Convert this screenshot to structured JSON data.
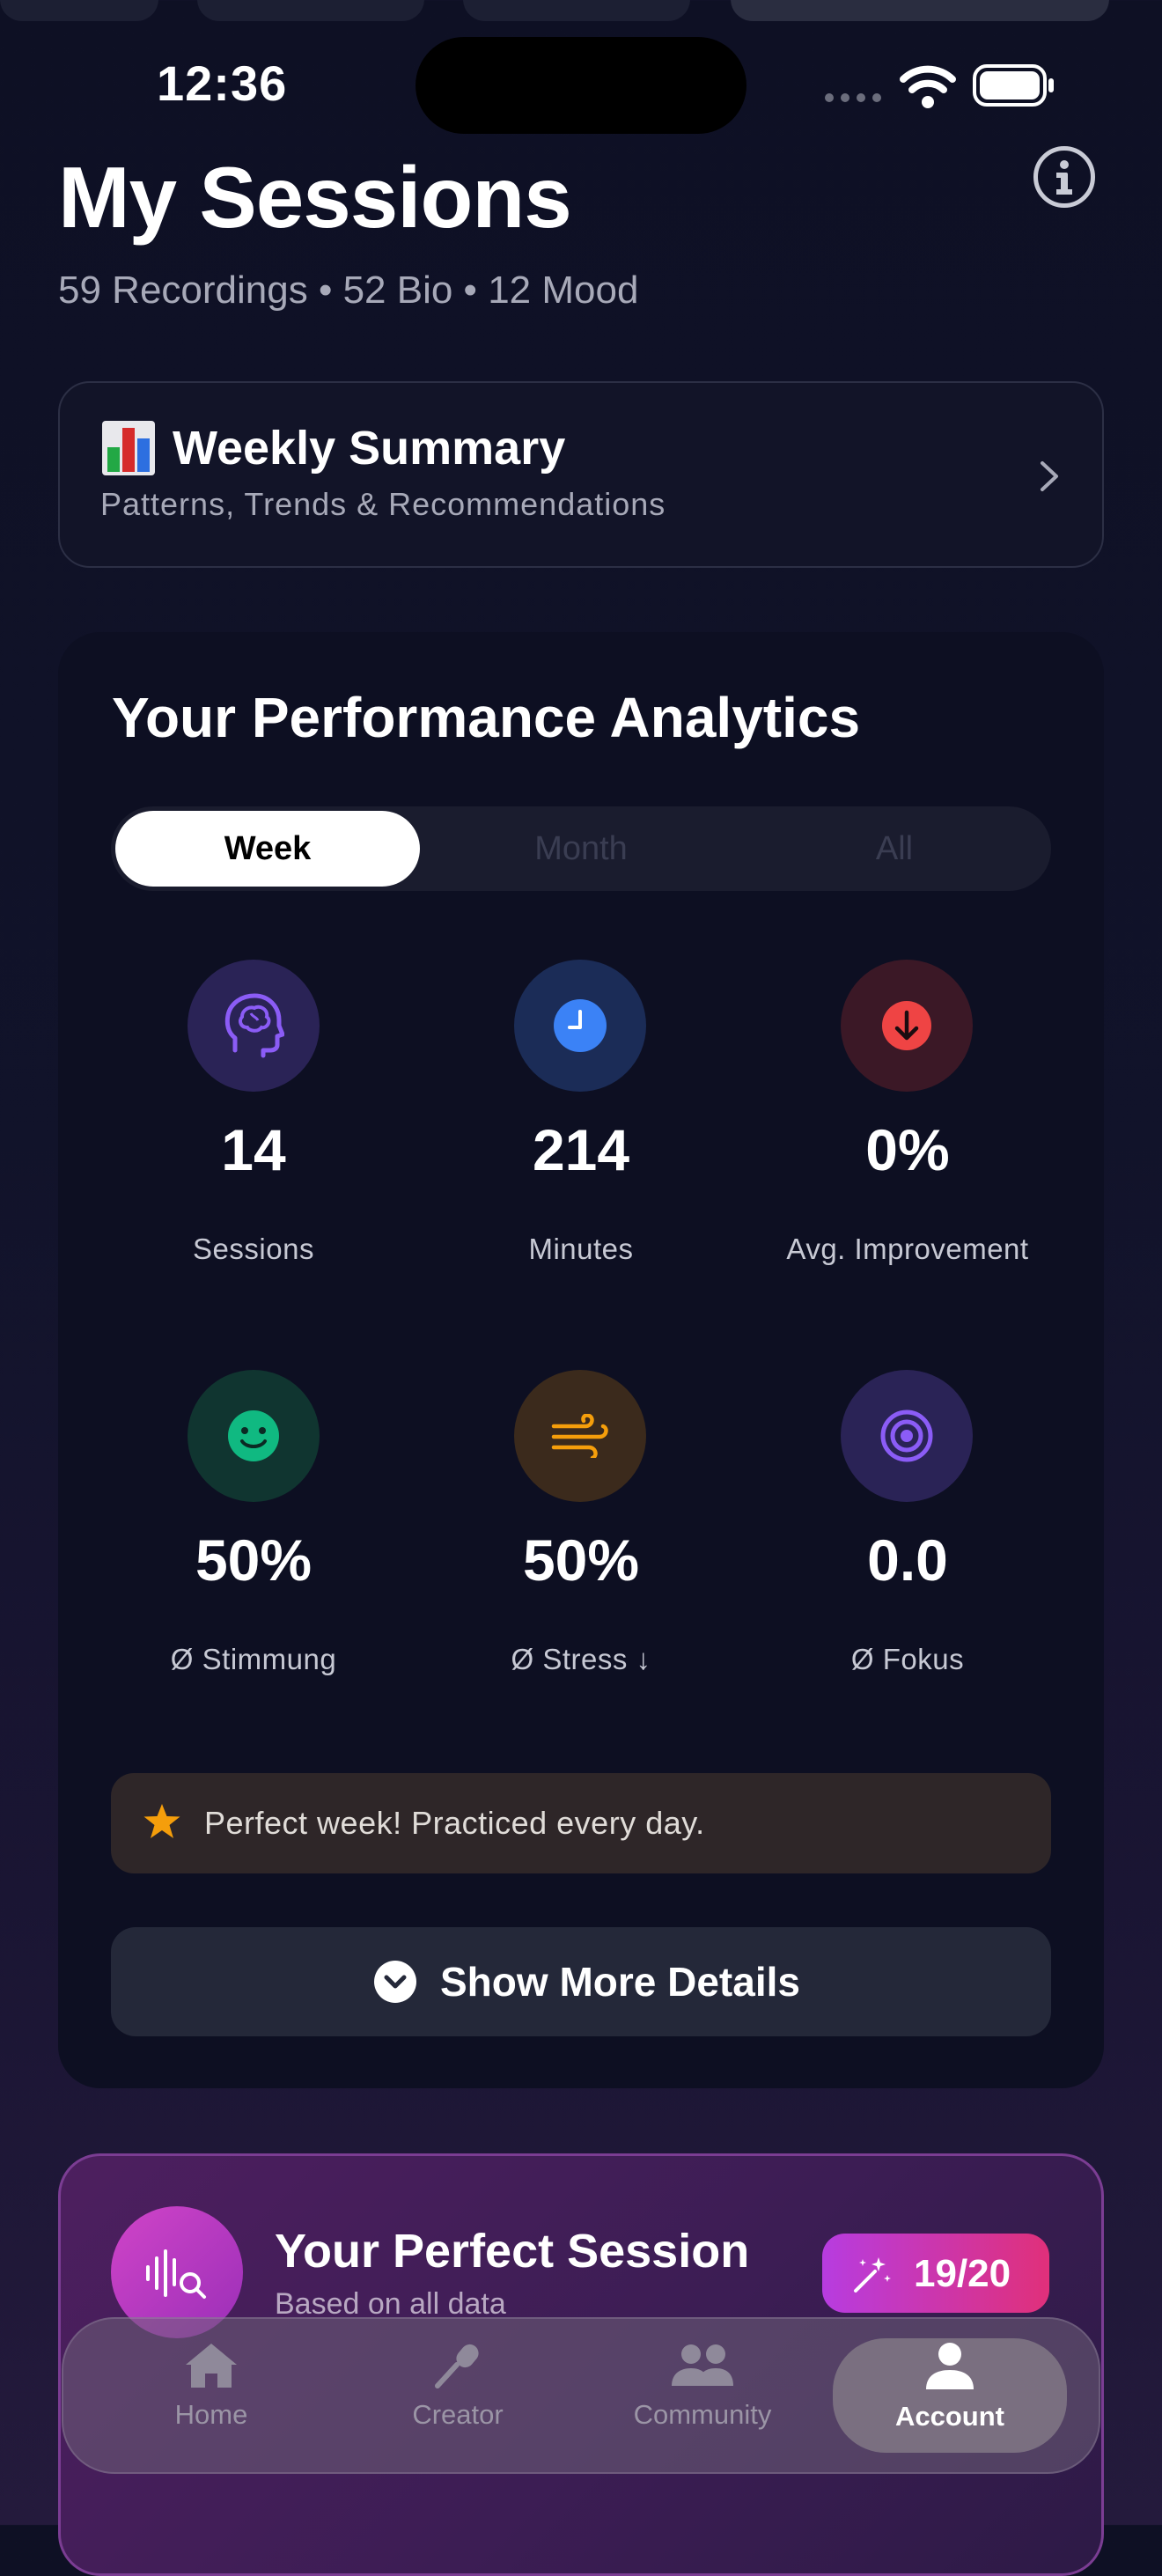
{
  "status_bar": {
    "time": "12:36"
  },
  "header": {
    "title": "My Sessions",
    "subtitle": "59 Recordings • 52 Bio • 12 Mood"
  },
  "weekly_summary": {
    "emoji": "📊",
    "title": "Weekly Summary",
    "subtitle": "Patterns, Trends & Recommendations"
  },
  "analytics": {
    "title": "Your Performance Analytics",
    "tabs": [
      {
        "label": "Week",
        "active": true
      },
      {
        "label": "Month",
        "active": false
      },
      {
        "label": "All",
        "active": false
      }
    ],
    "stats": [
      {
        "value": "14",
        "label": "Sessions",
        "icon": "brain-icon",
        "color": "#8b5cf6"
      },
      {
        "value": "214",
        "label": "Minutes",
        "icon": "clock-icon",
        "color": "#3b82f6"
      },
      {
        "value": "0%",
        "label": "Avg. Improvement",
        "icon": "arrow-down-icon",
        "color": "#ef4444"
      },
      {
        "value": "50%",
        "label": "Ø Stimmung",
        "icon": "smile-icon",
        "color": "#10b981"
      },
      {
        "value": "50%",
        "label": "Ø Stress ↓",
        "icon": "wind-icon",
        "color": "#f59e0b"
      },
      {
        "value": "0.0",
        "label": "Ø Fokus",
        "icon": "target-icon",
        "color": "#8b5cf6"
      }
    ],
    "banner": "Perfect week! Practiced every day.",
    "more_button": "Show More Details"
  },
  "perfect_session": {
    "title": "Your Perfect Session",
    "subtitle": "Based on all data",
    "score": "19/20"
  },
  "tabbar": [
    {
      "label": "Home",
      "icon": "house-icon",
      "active": false
    },
    {
      "label": "Creator",
      "icon": "microphone-icon",
      "active": false
    },
    {
      "label": "Community",
      "icon": "people-icon",
      "active": false
    },
    {
      "label": "Account",
      "icon": "person-icon",
      "active": true
    }
  ]
}
